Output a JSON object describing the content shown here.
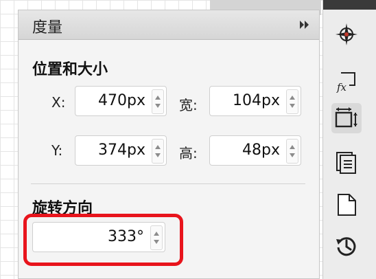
{
  "panel": {
    "title": "度量",
    "position_size": {
      "title": "位置和大小",
      "x_label": "X:",
      "x_value": "470px",
      "y_label": "Y:",
      "y_value": "374px",
      "width_label": "宽:",
      "width_value": "104px",
      "height_label": "高:",
      "height_value": "48px"
    },
    "rotation": {
      "title": "旋转方向",
      "value": "333°"
    }
  },
  "toolbar": {
    "icons": [
      "compass-icon",
      "formula-fx-icon",
      "resize-icon",
      "layers-icon",
      "page-icon",
      "history-icon"
    ],
    "active": "resize-icon"
  },
  "colors": {
    "highlight": "#e8141c",
    "panel_bg": "#f4f4f4",
    "header_bg": "#dcdcdc"
  }
}
